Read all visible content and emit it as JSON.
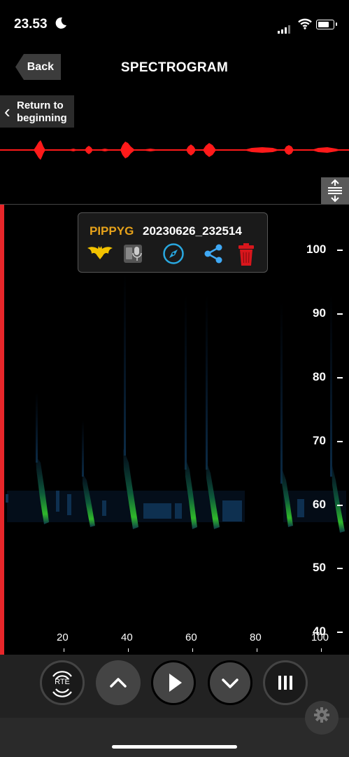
{
  "status_bar": {
    "time": "23.53",
    "icons": [
      "moon-icon",
      "cellular-signal-icon",
      "wifi-icon",
      "battery-icon"
    ]
  },
  "nav": {
    "back_label": "Back",
    "title": "SPECTROGRAM"
  },
  "return_button": {
    "label_line1": "Return to",
    "label_line2": "beginning"
  },
  "info_popup": {
    "species_code": "PIPPYG",
    "recording_id": "20230626_232514",
    "icons": [
      "bat-icon",
      "recorder-icon",
      "compass-icon",
      "share-icon",
      "trash-icon"
    ]
  },
  "y_axis": {
    "ticks": [
      "100",
      "90",
      "80",
      "70",
      "60",
      "50",
      "40"
    ],
    "range": [
      40,
      100
    ]
  },
  "x_axis": {
    "ticks": [
      "20",
      "40",
      "60",
      "80",
      "100"
    ]
  },
  "controls": {
    "rte_label": "RTE",
    "buttons": [
      "rte-button",
      "scroll-up-button",
      "play-button",
      "scroll-down-button",
      "bars-menu-button"
    ]
  },
  "colors": {
    "waveform": "#ff1a1a",
    "playhead": "#e8262a",
    "species_code": "#e6a21a",
    "compass": "#29a8e0",
    "share": "#3fa9f5",
    "trash": "#d8161c",
    "bat": "#f2c200"
  }
}
